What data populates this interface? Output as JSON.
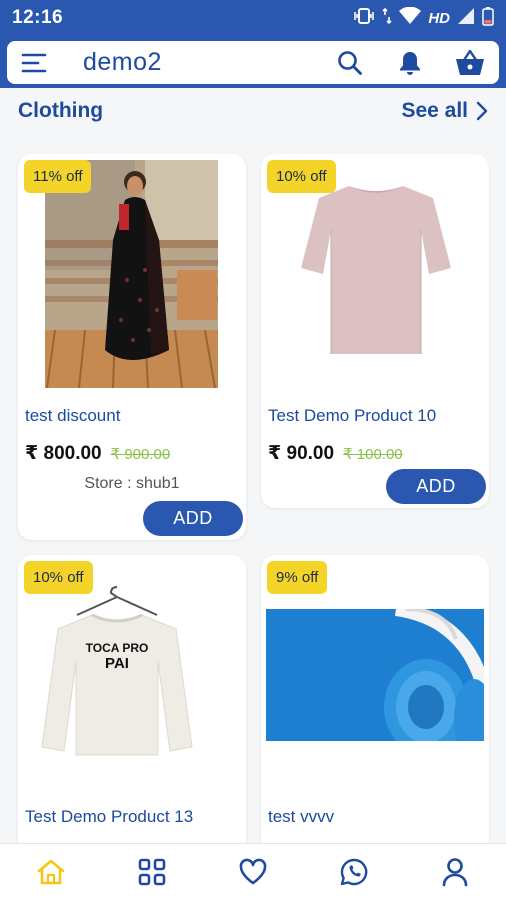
{
  "status_bar": {
    "time": "12:16",
    "network": "HD"
  },
  "app_bar": {
    "title": "demo2",
    "icons": [
      "menu-icon",
      "search-icon",
      "bell-icon",
      "basket-icon"
    ]
  },
  "section": {
    "title": "Clothing",
    "see_all": "See all"
  },
  "products": [
    {
      "badge": "11% off",
      "name": "test discount",
      "price": "₹ 800.00",
      "old_price": "₹ 900.00",
      "store": "Store : shub1",
      "add_label": "ADD"
    },
    {
      "badge": "10% off",
      "name": "Test Demo Product 10",
      "price": "₹ 90.00",
      "old_price": "₹ 100.00",
      "add_label": "ADD"
    },
    {
      "badge": "10% off",
      "name": "Test Demo Product 13",
      "shirt_text_line1": "TOCA PRO",
      "shirt_text_line2": "PAI"
    },
    {
      "badge": "9% off",
      "name": "test vvvv"
    }
  ],
  "bottom_nav": [
    "home-icon",
    "categories-icon",
    "wishlist-icon",
    "whatsapp-icon",
    "profile-icon"
  ],
  "colors": {
    "primary": "#2a58b0",
    "accent_text": "#1e4aa0",
    "badge": "#f5d42a",
    "old_price": "#8bc34a",
    "active_nav": "#f5c518"
  }
}
